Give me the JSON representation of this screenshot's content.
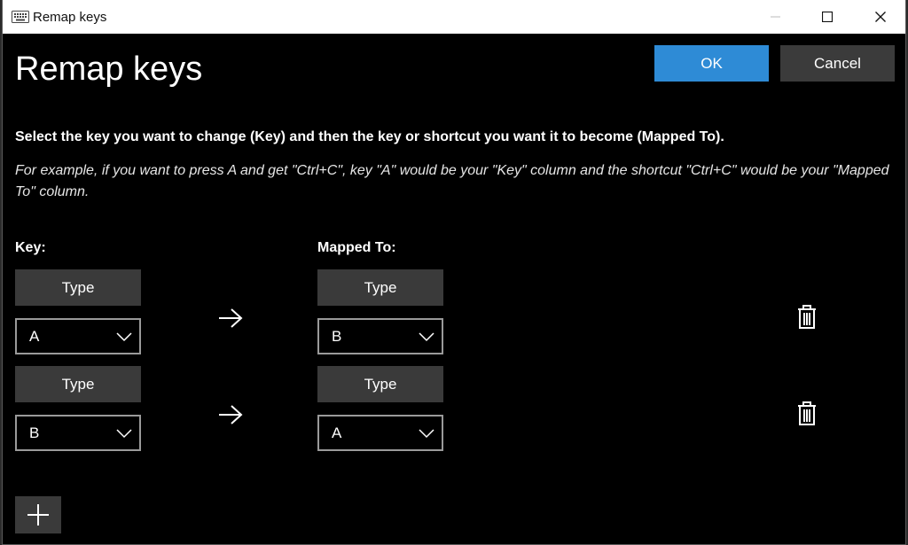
{
  "window": {
    "title": "Remap keys",
    "controls": [
      "minimize",
      "maximize",
      "close"
    ]
  },
  "heading": "Remap keys",
  "actions": {
    "ok_label": "OK",
    "cancel_label": "Cancel"
  },
  "instructions": "Select the key you want to change (Key) and then the key or shortcut you want it to become (Mapped To).",
  "example": "For example, if you want to press A and get \"Ctrl+C\", key \"A\" would be your \"Key\" column and the shortcut \"Ctrl+C\" would be your \"Mapped To\" column.",
  "columns": {
    "key_label": "Key:",
    "mapped_label": "Mapped To:"
  },
  "rows": [
    {
      "key_type_label": "Type",
      "key_value": "A",
      "mapped_type_label": "Type",
      "mapped_value": "B"
    },
    {
      "key_type_label": "Type",
      "key_value": "B",
      "mapped_type_label": "Type",
      "mapped_value": "A"
    }
  ],
  "icons": {
    "app": "keyboard-icon",
    "arrow": "arrow-right-icon",
    "delete": "trash-icon",
    "add": "plus-icon",
    "dropdown": "chevron-down-icon"
  },
  "colors": {
    "accent": "#2e8bd6",
    "background": "#000000",
    "button": "#3a3a3a"
  }
}
